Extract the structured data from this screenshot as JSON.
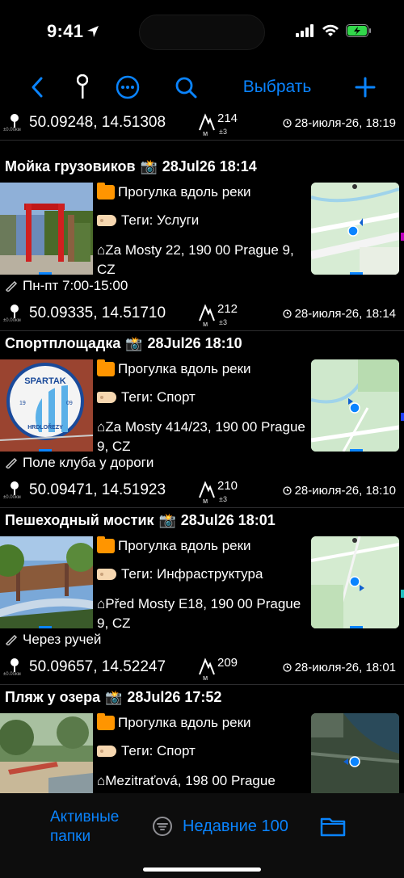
{
  "status": {
    "time": "9:41"
  },
  "toolbar": {
    "select_label": "Выбрать"
  },
  "partial_row": {
    "coords": "50.09248, 14.51308",
    "altitude": "214",
    "altitude_unit": "м",
    "accuracy": "±3",
    "date": "28-июля-26, 18:19",
    "scale": "±0.00км"
  },
  "items": [
    {
      "title": "Мойка грузовиков",
      "timestamp": "28Jul26 18:14",
      "folder": "Прогулка вдоль реки",
      "tags": "Теги: Услуги",
      "address": "⌂Za Mosty 22, 190 00 Prague 9, CZ",
      "note": "Пн-пт 7:00-15:00",
      "coords": "50.09335, 14.51710",
      "altitude": "212",
      "altitude_unit": "м",
      "accuracy": "±3",
      "date": "28-июля-26, 18:14",
      "scale": "±0.00км"
    },
    {
      "title": "Спортплощадка",
      "timestamp": "28Jul26 18:10",
      "folder": "Прогулка вдоль реки",
      "tags": "Теги: Спорт",
      "address": "⌂Za Mosty 414/23, 190 00 Prague 9, CZ",
      "note": "Поле клуба у дороги",
      "coords": "50.09471, 14.51923",
      "altitude": "210",
      "altitude_unit": "м",
      "accuracy": "±3",
      "date": "28-июля-26, 18:10",
      "scale": "±0.00км",
      "logo_text_top": "SPARTAK",
      "logo_text_bottom": "HRDLOŘEZY",
      "logo_left": "19",
      "logo_right": "09"
    },
    {
      "title": "Пешеходный мостик",
      "timestamp": "28Jul26 18:01",
      "folder": "Прогулка вдоль реки",
      "tags": "Теги: Инфраструктура",
      "address": "⌂Před Mosty E18, 190 00 Prague 9, CZ",
      "note": "Через ручей",
      "coords": "50.09657, 14.52247",
      "altitude": "209",
      "altitude_unit": "м",
      "accuracy": "",
      "date": "28-июля-26, 18:01",
      "scale": "±0.00км"
    },
    {
      "title": "Пляж у озера",
      "timestamp": "28Jul26 17:52",
      "folder": "Прогулка вдоль реки",
      "tags": "Теги: Спорт",
      "address": "⌂Mezitraťová, 198 00 Prague"
    }
  ],
  "bottom": {
    "active_folders_line1": "Активные",
    "active_folders_line2": "папки",
    "recent": "Недавние 100"
  },
  "colors": {
    "accent": "#0a84ff",
    "folder": "#ff9500",
    "background": "#000000"
  }
}
